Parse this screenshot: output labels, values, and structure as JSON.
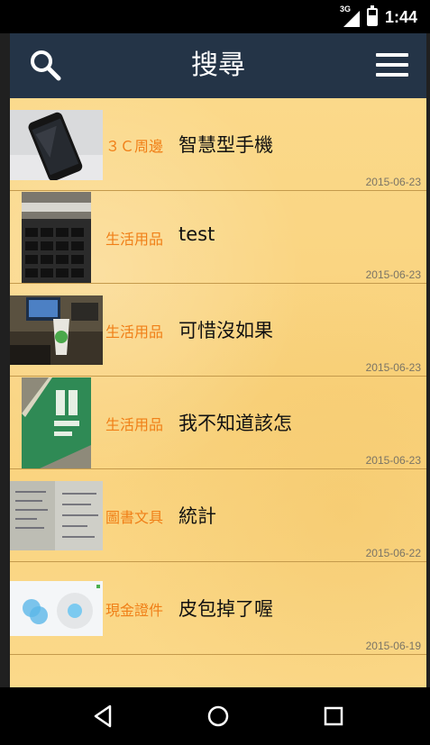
{
  "status_bar": {
    "network": "3G",
    "time": "1:44",
    "battery_level": 0.6
  },
  "app_bar": {
    "title": "搜尋",
    "search_icon": "search-icon",
    "menu_icon": "hamburger-menu-icon"
  },
  "items": [
    {
      "category": "３Ｃ周邊",
      "title": "智慧型手機",
      "date": "2015-06-23",
      "thumb": "smartphone-photo"
    },
    {
      "category": "生活用品",
      "title": "test",
      "date": "2015-06-23",
      "thumb": "keyboard-photo"
    },
    {
      "category": "生活用品",
      "title": "可惜沒如果",
      "date": "2015-06-23",
      "thumb": "desk-cup-photo"
    },
    {
      "category": "生活用品",
      "title": "我不知道該怎",
      "date": "2015-06-23",
      "thumb": "green-book-photo"
    },
    {
      "category": "圖書文具",
      "title": "統計",
      "date": "2015-06-22",
      "thumb": "notebook-photo"
    },
    {
      "category": "現金證件",
      "title": "皮包掉了喔",
      "date": "2015-06-19",
      "thumb": "app-screenshot-photo"
    }
  ],
  "nav_bar": {
    "back": "back-icon",
    "home": "home-icon",
    "recents": "recents-icon"
  },
  "colors": {
    "app_bar": "#243447",
    "category_text": "#f07f17",
    "list_background": "#fbd98a"
  }
}
